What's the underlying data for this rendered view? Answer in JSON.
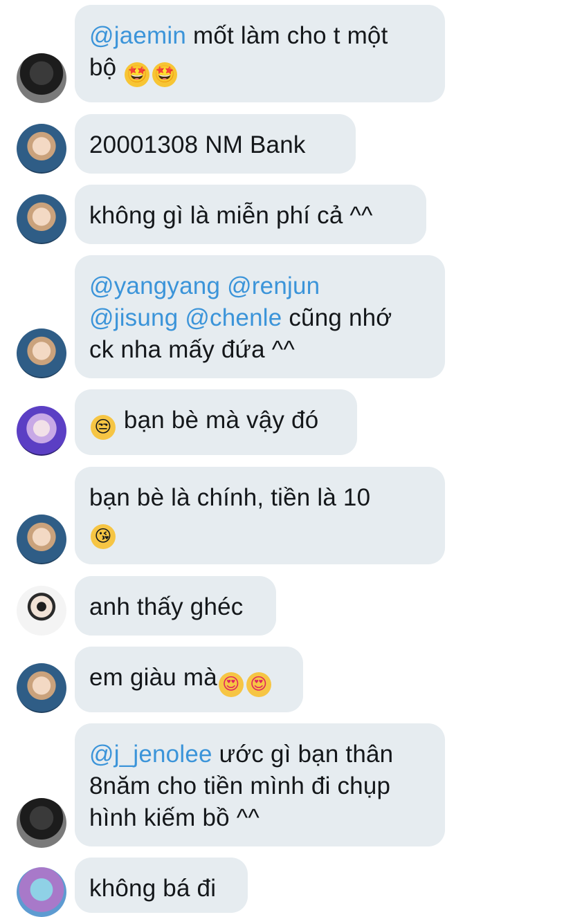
{
  "messages": [
    {
      "mention": "@jaemin",
      "line1": " mốt làm cho t một",
      "line2": "bộ ",
      "emojis": [
        "🤩",
        "🤩"
      ]
    },
    {
      "text": "20001308 NM Bank"
    },
    {
      "text": "không gì là miễn phí cả ^^"
    },
    {
      "mention1": "@yangyang",
      "mention2": "@renjun",
      "mention3": "@jisung",
      "mention4": "@chenle",
      "line2_rest": " cũng nhớ",
      "line3": "ck nha mấy đứa ^^"
    },
    {
      "emoji": "😒",
      "text": " bạn bè mà vậy đó"
    },
    {
      "line1": "bạn bè là chính, tiền là 10",
      "emoji": "😘"
    },
    {
      "text": "anh thấy ghéc"
    },
    {
      "text": "em giàu mà",
      "emojis": [
        "😍",
        "😍"
      ]
    },
    {
      "mention": "@j_jenolee",
      "line1": " ước gì bạn thân",
      "line2": "8năm cho tiền mình đi chụp",
      "line3": "hình kiếm bồ ^^"
    },
    {
      "text": "không bá đi"
    }
  ],
  "colors": {
    "bubble": "#e6ecf0",
    "mention": "#3b94d9",
    "text": "#14171a"
  }
}
